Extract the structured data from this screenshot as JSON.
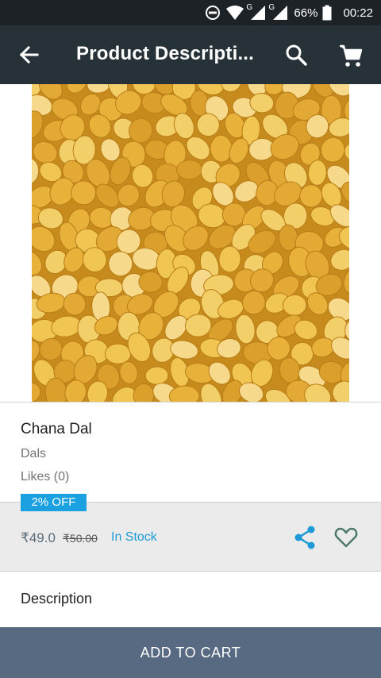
{
  "status_bar": {
    "network_label_1": "G",
    "network_label_2": "G",
    "battery": "66%",
    "time": "00:22",
    "icons": [
      "do-not-disturb-icon",
      "wifi-icon",
      "signal-icon",
      "signal-icon",
      "battery-icon"
    ]
  },
  "app_bar": {
    "title": "Product Descripti...",
    "icons": [
      "back-arrow-icon",
      "search-icon",
      "cart-icon"
    ]
  },
  "product": {
    "image_subject": "chana-dal-lentils",
    "name": "Chana Dal",
    "category": "Dals",
    "likes": "Likes (0)",
    "discount_badge": "2% OFF",
    "price": "₹49.0",
    "mrp": "₹50.00",
    "stock": "In Stock"
  },
  "actions": {
    "icons": [
      "share-icon",
      "heart-icon"
    ]
  },
  "section": {
    "description_label": "Description"
  },
  "footer": {
    "add_to_cart_label": "ADD TO CART"
  },
  "colors": {
    "status_bar": "#1d2227",
    "app_bar": "#263238",
    "accent": "#1ba1e2",
    "price_bar": "#ebebeb",
    "button": "#576a82",
    "lentil": "#e6b13a"
  }
}
